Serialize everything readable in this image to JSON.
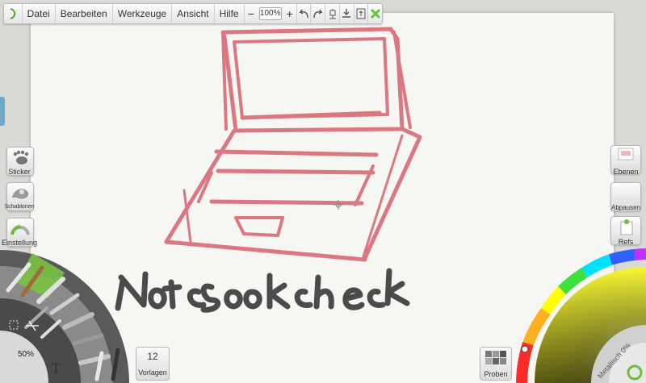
{
  "menubar": {
    "items": [
      "Datei",
      "Bearbeiten",
      "Werkzeuge",
      "Ansicht",
      "Hilfe"
    ],
    "zoom_minus": "−",
    "zoom_value": "100%",
    "zoom_plus": "+"
  },
  "left_panel": {
    "sticker": "Sticker",
    "schablonen": "Schablonen",
    "einstellung": "Einstellung"
  },
  "tool_wheel": {
    "brush_size": "50%"
  },
  "vorlagen": {
    "count": "12",
    "label": "Vorlagen"
  },
  "right_panel": {
    "ebenen": "Ebenen",
    "abpausen": "Abpausen",
    "refs": "Refs"
  },
  "proben": {
    "label": "Proben"
  },
  "color_picker": {
    "metallic_label": "Metallisch 0%"
  },
  "canvas": {
    "handwriting": "NoteBookCheck"
  },
  "colors": {
    "sketch_red": "#d96a74",
    "ink_black": "#2e2e2e",
    "accent_green": "#7ac142"
  }
}
